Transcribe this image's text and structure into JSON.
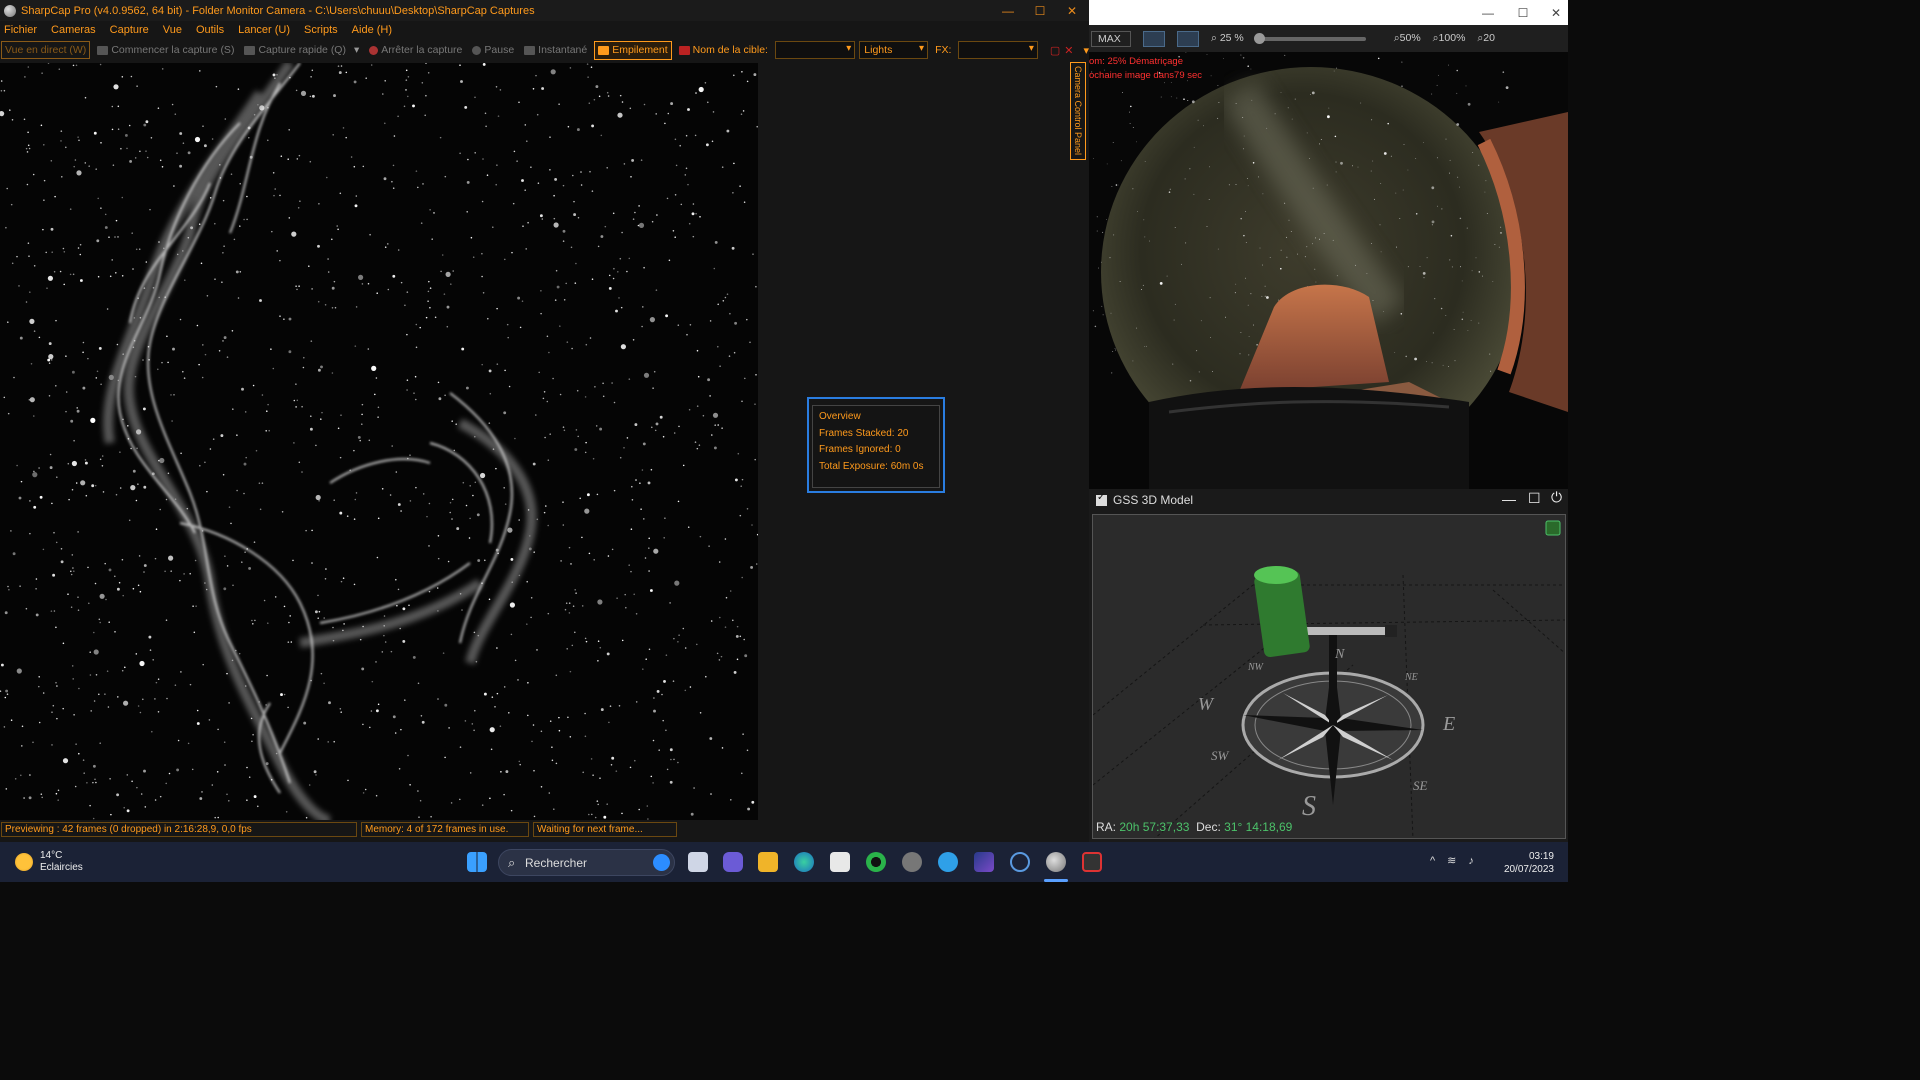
{
  "sharpcap": {
    "title": "SharpCap Pro (v4.0.9562, 64 bit) - Folder Monitor Camera - C:\\Users\\chuuu\\Desktop\\SharpCap Captures",
    "menu": [
      "Fichier",
      "Cameras",
      "Capture",
      "Vue",
      "Outils",
      "Lancer (U)",
      "Scripts",
      "Aide (H)"
    ],
    "toolbar": {
      "live_view": "Vue en direct (W)",
      "start_capture": "Commencer la capture (S)",
      "quick_capture": "Capture rapide (Q)",
      "stop_capture": "Arrêter la capture",
      "pause": "Pause",
      "snapshot": "Instantané",
      "stacking": "Empilement",
      "target_label": "Nom de la cible:",
      "target_value": "",
      "frame_type": "Lights",
      "fx_label": "FX:",
      "fx_value": ""
    },
    "side_tab": "Camera Control Panel",
    "overview": {
      "title": "Overview",
      "stacked": "Frames Stacked: 20",
      "ignored": "Frames Ignored: 0",
      "exposure": "Total Exposure:   60m 0s"
    },
    "status": {
      "preview": "Previewing : 42 frames (0 dropped) in 2:16:28,9, 0,0 fps",
      "memory": "Memory: 4 of 172 frames in use.",
      "waiting": "Waiting for next frame..."
    }
  },
  "allsky": {
    "toolbar": {
      "max": "MAX",
      "zoom_25": "25 %",
      "zoom_50": "50%",
      "zoom_100": "100%",
      "zoom_200": "20"
    },
    "overlay_line1": "om: 25%   Dématriçage",
    "overlay_line2": "ochaine image dans79 sec"
  },
  "gss": {
    "title": "GSS 3D Model",
    "ra_label": "RA:",
    "ra_value": "20h 57:37,33",
    "dec_label": "Dec:",
    "dec_value": "31° 14:18,69",
    "compass": {
      "n": "N",
      "s": "S",
      "e": "E",
      "w": "W",
      "nw": "NW",
      "ne": "NE",
      "sw": "SW",
      "se": "SE"
    }
  },
  "taskbar": {
    "temperature": "14°C",
    "weather": "Eclaircies",
    "search_placeholder": "Rechercher",
    "time": "03:19",
    "date": "20/07/2023"
  },
  "colors": {
    "accent": "#ff9a1c",
    "overview_border": "#2a7de0",
    "radec_value": "#4cc26a"
  }
}
